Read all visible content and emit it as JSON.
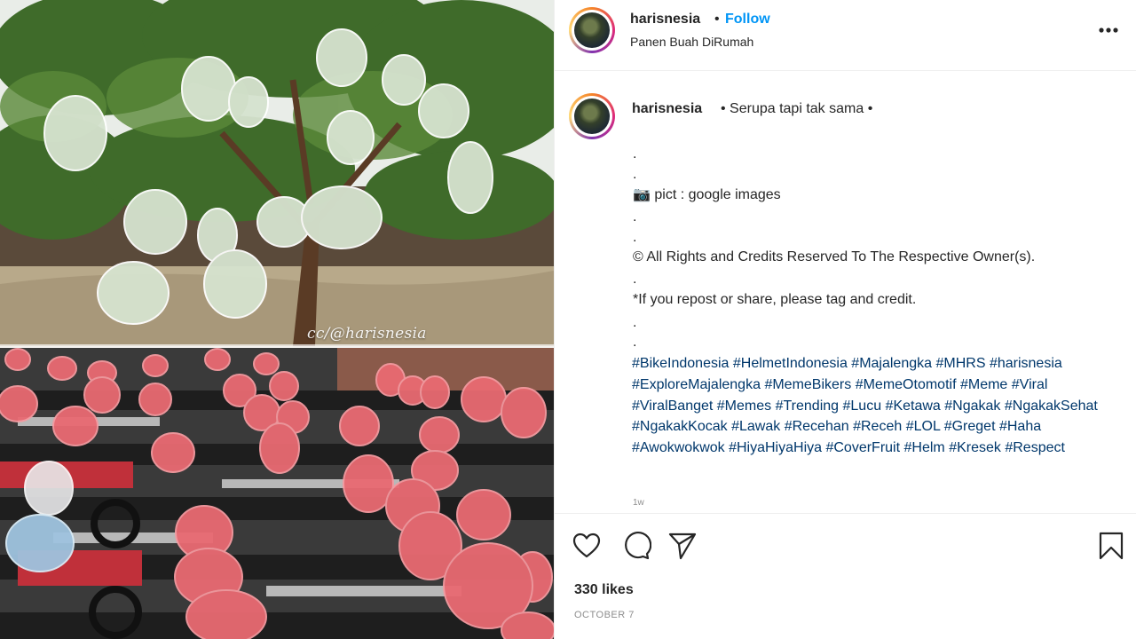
{
  "post": {
    "image": {
      "watermark": "cc/@harisnesia",
      "description_top": "guava-tree-with-bagged-fruit",
      "description_bottom": "parked-motorcycles-with-red-plastic-bags"
    },
    "header": {
      "username": "harisnesia",
      "separator": "•",
      "follow_label": "Follow",
      "location": "Panen Buah DiRumah",
      "more_icon": "more-horizontal-icon"
    },
    "caption": {
      "username": "harisnesia",
      "text": "• Serupa tapi tak sama •",
      "lines": [
        {
          "text": "."
        },
        {
          "text": "."
        },
        {
          "text": "📷 pict : google images"
        },
        {
          "text": "."
        },
        {
          "text": "."
        },
        {
          "text": "© All Rights and Credits Reserved To The Respective Owner(s)."
        },
        {
          "text": "."
        },
        {
          "text": "*If you repost or share, please tag and credit."
        },
        {
          "text": "."
        },
        {
          "text": "."
        }
      ],
      "hashtags": [
        "#BikeIndonesia",
        "#HelmetIndonesia",
        "#Majalengka",
        "#MHRS",
        "#harisnesia",
        "#ExploreMajalengka",
        "#MemeBikers",
        "#MemeOtomotif",
        "#Meme",
        "#Viral",
        "#ViralBanget",
        "#Memes",
        "#Trending",
        "#Lucu",
        "#Ketawa",
        "#Ngakak",
        "#NgakakSehat",
        "#NgakakKocak",
        "#Lawak",
        "#Recehan",
        "#Receh",
        "#LOL",
        "#Greget",
        "#Haha",
        "#Awokwokwok",
        "#HiyaHiyaHiya",
        "#CoverFruit",
        "#Helm",
        "#Kresek",
        "#Respect"
      ],
      "time": "1w"
    },
    "actions": {
      "like_icon": "heart-icon",
      "comment_icon": "comment-icon",
      "share_icon": "paper-plane-icon",
      "save_icon": "bookmark-icon",
      "likes": "330 likes",
      "date": "OCTOBER 7"
    },
    "colors": {
      "link_blue": "#0095f6",
      "hashtag": "#00376b",
      "text": "#262626",
      "muted": "#8e8e8e",
      "border": "#efefef"
    }
  }
}
